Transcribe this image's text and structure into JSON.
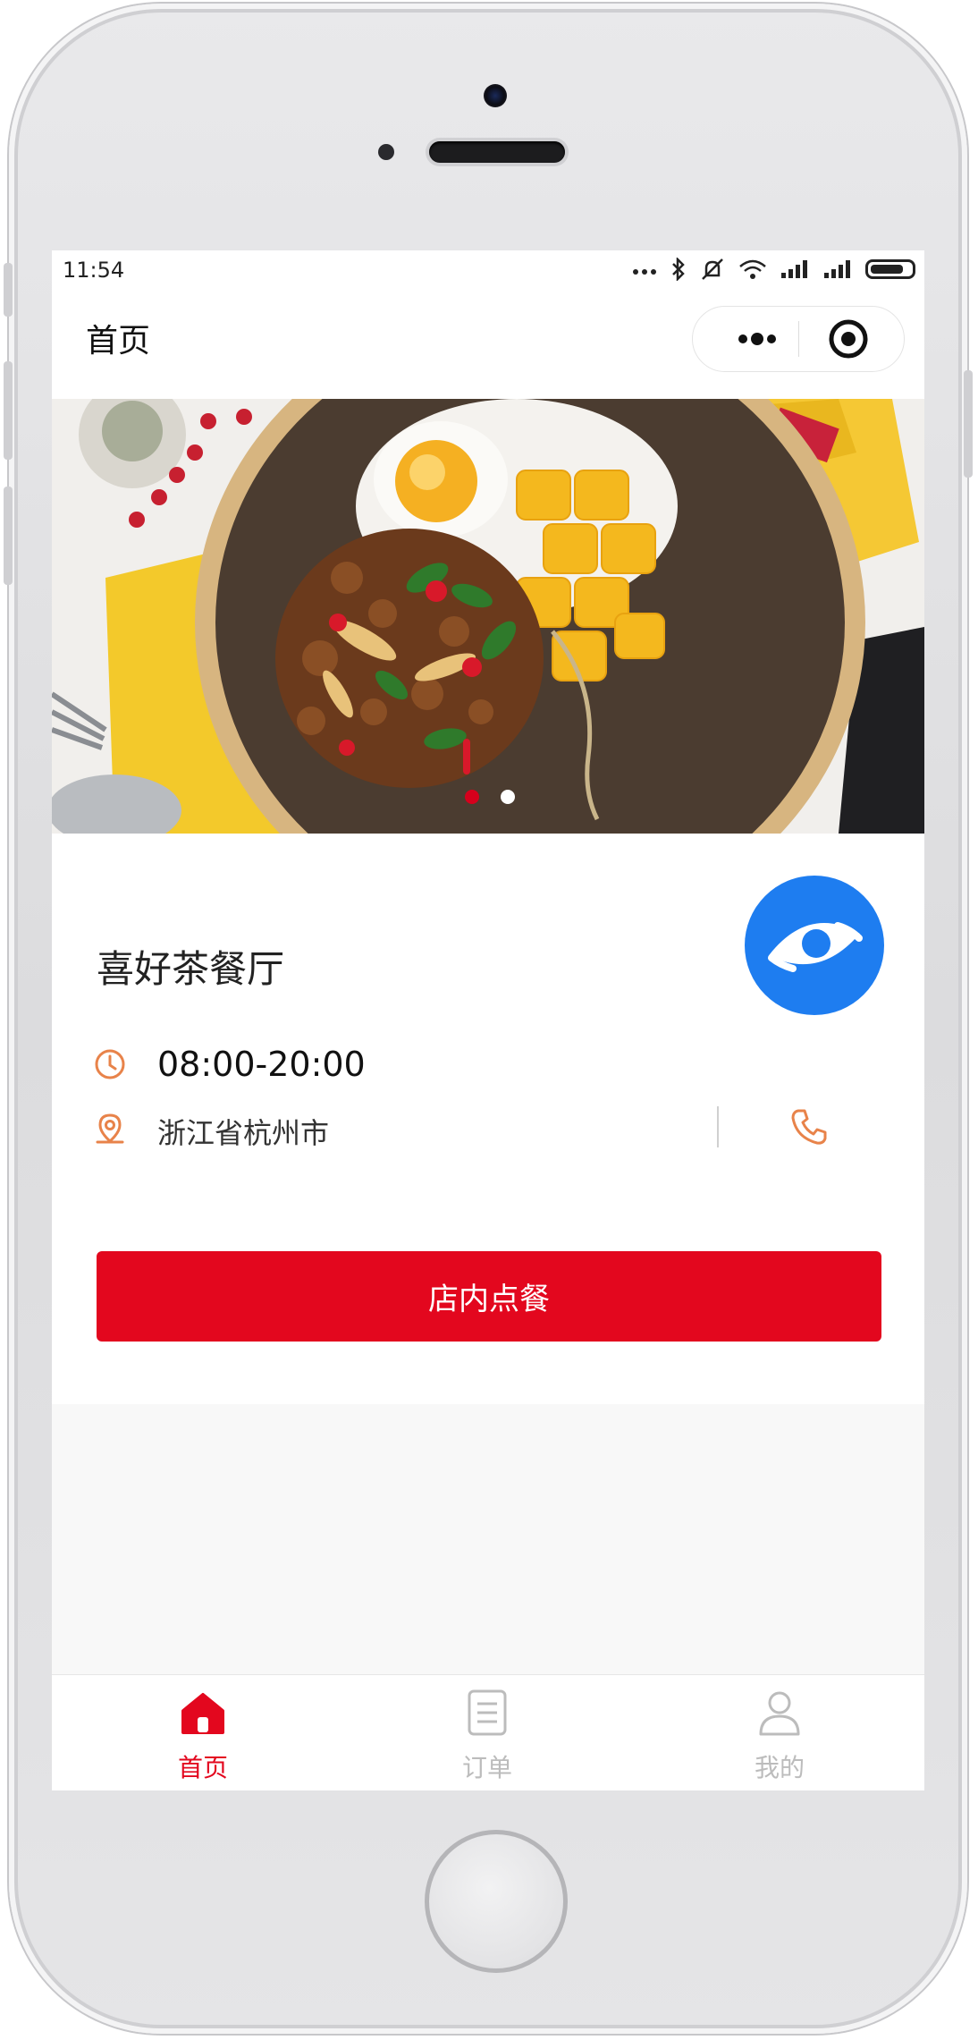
{
  "status_bar": {
    "time": "11:54"
  },
  "nav": {
    "title": "首页"
  },
  "banner": {
    "slide_count": 2,
    "active_slide": 1
  },
  "store": {
    "name": "喜好茶餐厅",
    "hours": "08:00-20:00",
    "address": "浙江省杭州市"
  },
  "actions": {
    "order_button": "店内点餐"
  },
  "tabbar": {
    "items": [
      {
        "label": "首页",
        "icon": "home-icon",
        "active": true
      },
      {
        "label": "订单",
        "icon": "document-icon",
        "active": false
      },
      {
        "label": "我的",
        "icon": "user-icon",
        "active": false
      }
    ]
  },
  "colors": {
    "accent_red": "#e3071e",
    "icon_orange": "#e8834a",
    "logo_blue": "#1e7df0",
    "inactive_gray": "#bcbcbc"
  }
}
